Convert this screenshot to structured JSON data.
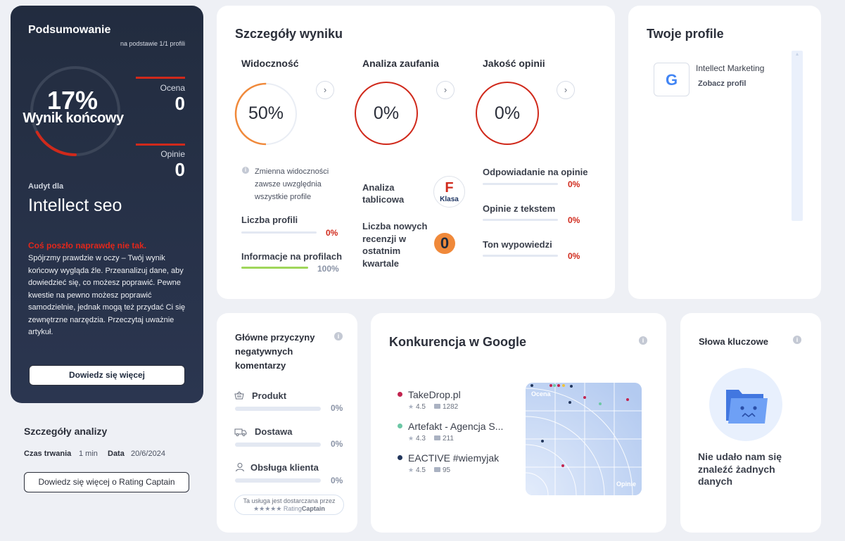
{
  "summary": {
    "title": "Podsumowanie",
    "basis": "na podstawie 1/1 profili",
    "score": "17%",
    "score_label": "Wynik końcowy",
    "score_fraction": 0.17,
    "rating_label": "Ocena",
    "rating_value": "0",
    "reviews_label": "Opinie",
    "reviews_value": "0",
    "audit_for": "Audyt dla",
    "company": "Intellect seo",
    "warning_title": "Coś poszło naprawdę nie tak.",
    "warning_text": "Spójrzmy prawdzie w oczy – Twój wynik końcowy wygląda źle. Przeanalizuj dane, aby dowiedzieć się, co możesz poprawić. Pewne kwestie na pewno możesz poprawić samodzielnie, jednak mogą też przydać Ci się zewnętrzne narzędzia. Przeczytaj uważnie artykuł.",
    "cta": "Dowiedz się więcej"
  },
  "analysis": {
    "title": "Szczegóły analizy",
    "duration_label": "Czas trwania",
    "duration_value": "1 min",
    "date_label": "Data",
    "date_value": "20/6/2024",
    "cta": "Dowiedz się więcej o Rating Captain"
  },
  "details": {
    "title": "Szczegóły wyniku",
    "visibility": {
      "title": "Widoczność",
      "value": "50%",
      "fraction": 0.5,
      "note": "Zmienna widoczności zawsze uwzględnia wszystkie profile",
      "profiles_label": "Liczba profili",
      "profiles_value": "0%",
      "profiles_fraction": 0,
      "info_label": "Informacje na profilach",
      "info_value": "100%",
      "info_fraction": 1
    },
    "trust": {
      "title": "Analiza zaufania",
      "value": "0%",
      "table_label": "Analiza tablicowa",
      "grade": "F",
      "grade_label": "Klasa",
      "new_reviews_label": "Liczba nowych recenzji w ostatnim kwartale",
      "new_reviews_value": "0"
    },
    "quality": {
      "title": "Jakość opinii",
      "value": "0%",
      "reply_label": "Odpowiadanie na opinie",
      "reply_value": "0%",
      "text_label": "Opinie z tekstem",
      "text_value": "0%",
      "tone_label": "Ton wypowiedzi",
      "tone_value": "0%"
    }
  },
  "profiles": {
    "title": "Twoje profile",
    "items": [
      {
        "name": "Intellect Marketing",
        "link": "Zobacz profil",
        "icon": "google-logo"
      }
    ]
  },
  "negatives": {
    "title": "Główne przyczyny negatywnych komentarzy",
    "items": [
      {
        "label": "Produkt",
        "value": "0%",
        "icon": "basket-icon"
      },
      {
        "label": "Dostawa",
        "value": "0%",
        "icon": "truck-icon"
      },
      {
        "label": "Obsługa klienta",
        "value": "0%",
        "icon": "user-icon"
      }
    ],
    "provided_by": "Ta usługa jest dostarczana przez",
    "brand_prefix": "Rating",
    "brand_suffix": "Captain"
  },
  "competition": {
    "title": "Konkurencja w Google",
    "items": [
      {
        "name": "TakeDrop.pl",
        "rating": "4.5",
        "reviews": "1282",
        "color": "#c2244f"
      },
      {
        "name": "Artefakt - Agencja S...",
        "rating": "4.3",
        "reviews": "211",
        "color": "#6cc7a5"
      },
      {
        "name": "EACTIVE #wiemyjak",
        "rating": "4.5",
        "reviews": "95",
        "color": "#22365c"
      }
    ],
    "chart_xlabel": "Opinie",
    "chart_ylabel": "Ocena"
  },
  "keywords": {
    "title": "Słowa kluczowe",
    "empty": "Nie udało nam się znaleźć żadnych danych"
  },
  "colors": {
    "dark_card": "#1f2a3d",
    "accent_red": "#d0291b",
    "accent_orange": "#f0893a",
    "accent_green": "#9fd65a"
  }
}
